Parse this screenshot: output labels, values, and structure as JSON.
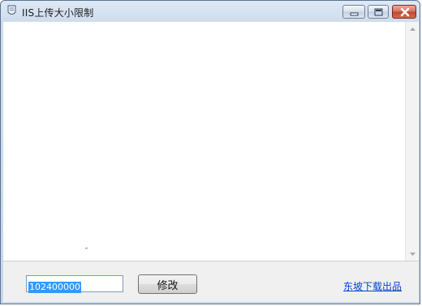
{
  "window": {
    "title": "IIS上传大小限制",
    "icons": {
      "app": "app-icon",
      "minimize": "minimize-icon",
      "maximize": "maximize-icon",
      "close": "close-icon"
    }
  },
  "log": {
    "text": ""
  },
  "scrollbar": {
    "up_icon": "scroll-up-arrow-icon",
    "down_icon": "scroll-down-arrow-icon"
  },
  "controls": {
    "size_value": "102400000",
    "modify_label": "修改",
    "credit_link": "东坡下载出品"
  },
  "colors": {
    "title_gradient": "#dfe9f5",
    "close_button": "#c0452c",
    "selection": "#3399ff",
    "link": "#0044cc"
  }
}
